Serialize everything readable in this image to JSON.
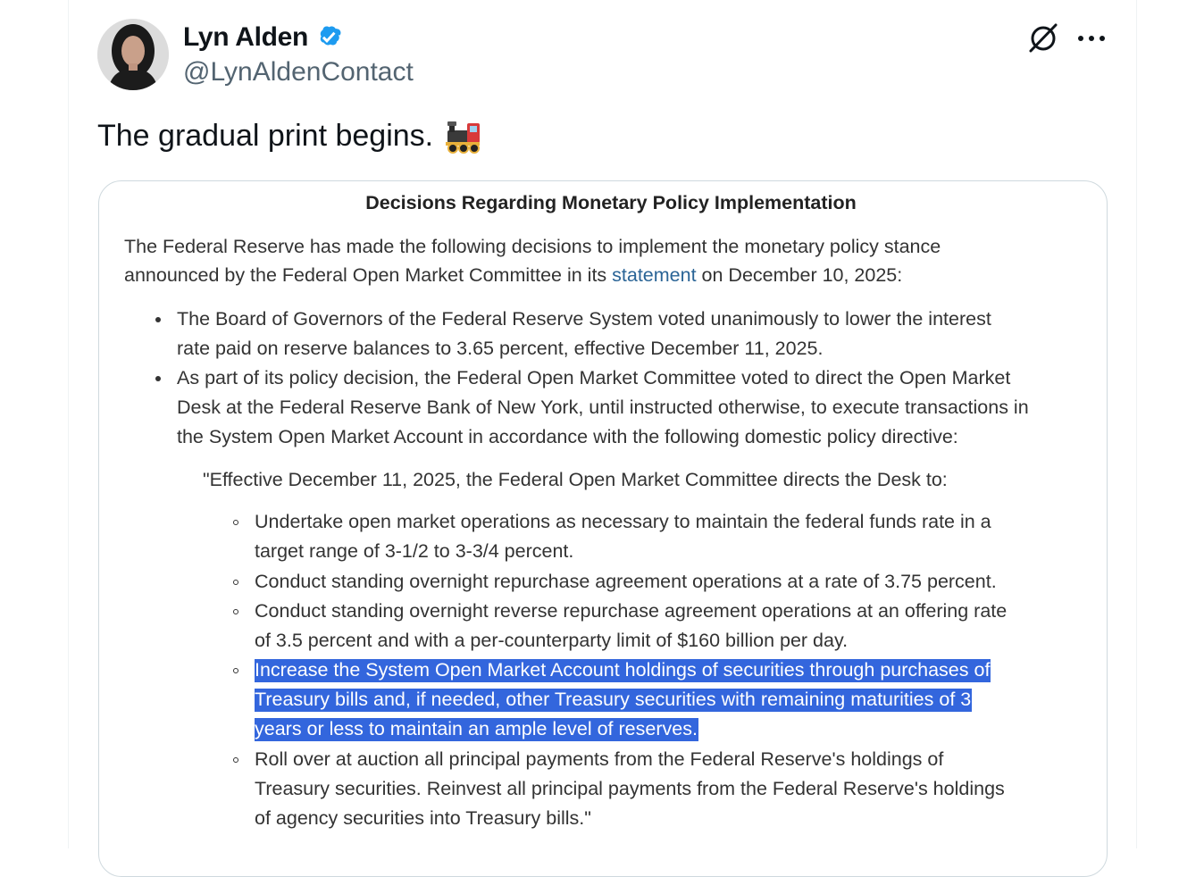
{
  "author": {
    "name": "Lyn Alden",
    "handle": "@LynAldenContact",
    "verified": true,
    "avatar": "profile-photo"
  },
  "actions": {
    "grok_icon": "grok-icon",
    "more_icon": "more-options-icon"
  },
  "tweet": {
    "text": "The gradual print begins.",
    "emoji": "locomotive-emoji"
  },
  "document": {
    "title": "Decisions Regarding Monetary Policy Implementation",
    "intro_line1": "The Federal Reserve has made the following decisions to implement the monetary policy stance",
    "intro_line2_before": "announced by the Federal Open Market Committee in its ",
    "intro_link": "statement",
    "intro_line2_after": " on December 10, 2025:",
    "bullets": [
      {
        "lines": [
          "The Board of Governors of the Federal Reserve System voted unanimously to lower the interest",
          "rate paid on reserve balances to 3.65 percent, effective December 11, 2025."
        ]
      },
      {
        "lines": [
          "As part of its policy decision, the Federal Open Market Committee voted to direct the Open Market",
          "Desk at the Federal Reserve Bank of New York, until instructed otherwise, to execute transactions in",
          "the System Open Market Account in accordance with the following domestic policy directive:"
        ]
      }
    ],
    "directive_intro": "\"Effective December 11, 2025, the Federal Open Market Committee directs the Desk to:",
    "directives": [
      {
        "lines": [
          "Undertake open market operations as necessary to maintain the federal funds rate in a",
          "target range of 3-1/2 to 3-3/4 percent."
        ]
      },
      {
        "lines": [
          "Conduct standing overnight repurchase agreement operations at a rate of 3.75 percent."
        ]
      },
      {
        "lines": [
          "Conduct standing overnight reverse repurchase agreement operations at an offering rate",
          "of 3.5 percent and with a per-counterparty limit of $160 billion per day."
        ]
      },
      {
        "highlighted": true,
        "lines": [
          "Increase the System Open Market Account holdings of securities through purchases of",
          "Treasury bills and, if needed, other Treasury securities with remaining maturities of 3",
          "years or less to maintain an ample level of reserves."
        ]
      },
      {
        "lines": [
          "Roll over at auction all principal payments from the Federal Reserve's holdings of",
          "Treasury securities. Reinvest all principal payments from the Federal Reserve's holdings",
          "of agency securities into Treasury bills.\""
        ]
      }
    ],
    "highlight_color": "#3366dd",
    "link_color": "#2a6496"
  },
  "colors": {
    "verified_blue": "#1d9bf0",
    "secondary_text": "#536471",
    "border": "#cfd9de"
  }
}
